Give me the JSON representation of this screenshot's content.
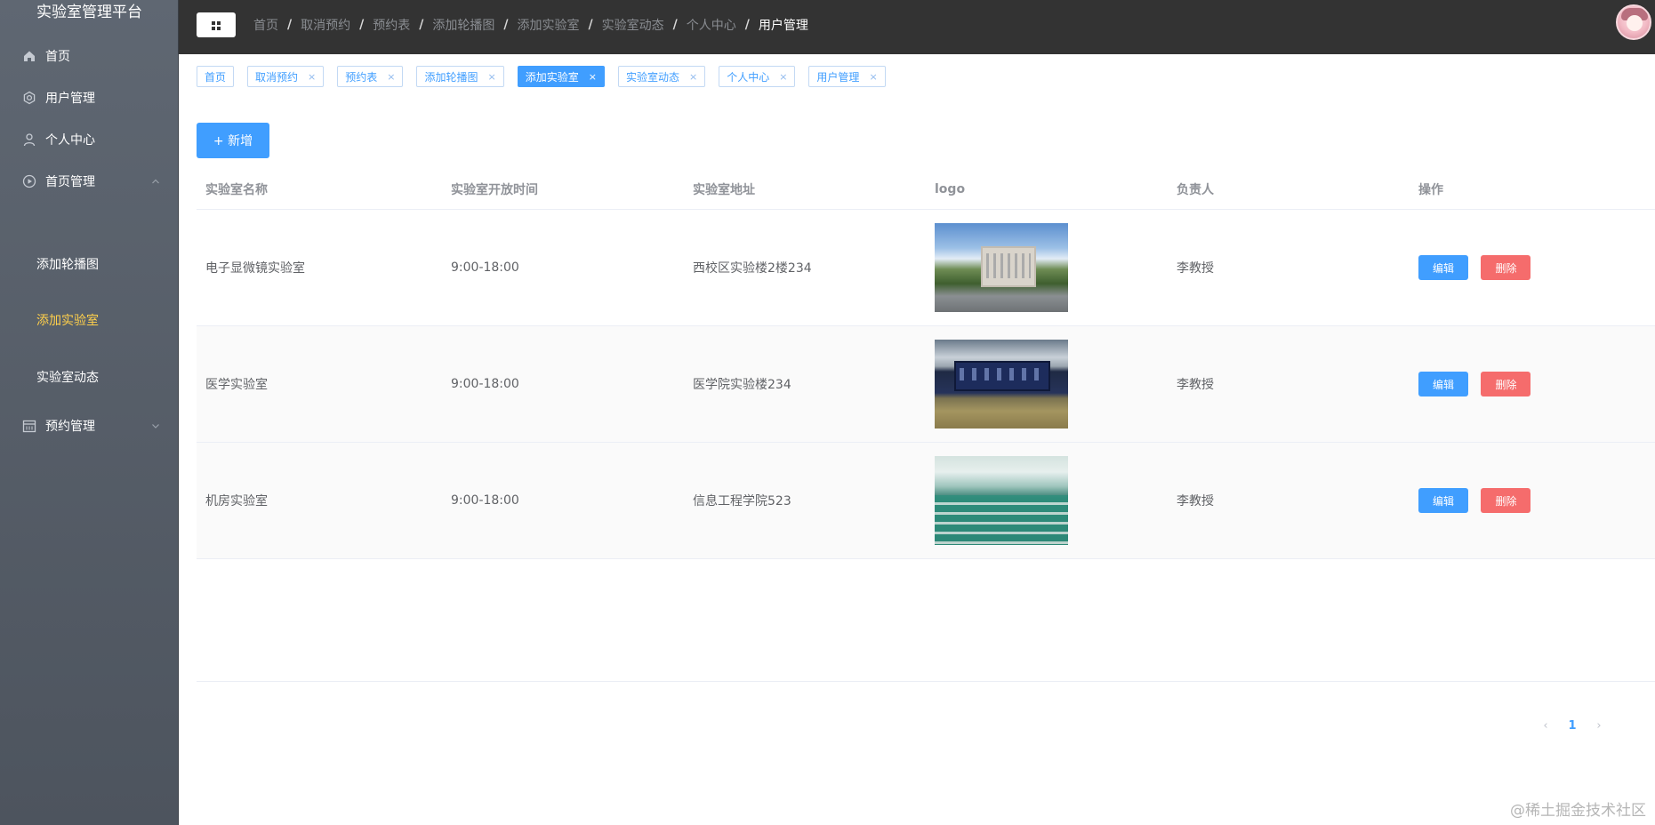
{
  "brand": "实验室管理平台",
  "sidebar": {
    "items": [
      {
        "label": "首页"
      },
      {
        "label": "用户管理"
      },
      {
        "label": "个人中心"
      },
      {
        "label": "首页管理"
      },
      {
        "label": "预约管理"
      }
    ],
    "sub_items": [
      {
        "label": "添加轮播图"
      },
      {
        "label": "添加实验室"
      },
      {
        "label": "实验室动态"
      }
    ],
    "active_sub": "添加实验室"
  },
  "breadcrumb": [
    {
      "label": "首页"
    },
    {
      "label": "取消预约"
    },
    {
      "label": "预约表"
    },
    {
      "label": "添加轮播图"
    },
    {
      "label": "添加实验室"
    },
    {
      "label": "实验室动态"
    },
    {
      "label": "个人中心"
    },
    {
      "label": "用户管理"
    }
  ],
  "tags": [
    {
      "label": "首页"
    },
    {
      "label": "取消预约"
    },
    {
      "label": "预约表"
    },
    {
      "label": "添加轮播图"
    },
    {
      "label": "添加实验室"
    },
    {
      "label": "实验室动态"
    },
    {
      "label": "个人中心"
    },
    {
      "label": "用户管理"
    }
  ],
  "tag_close_glyph": "×",
  "toolbar": {
    "add_label": "+ 新增"
  },
  "table": {
    "headers": [
      "实验室名称",
      "实验室开放时间",
      "实验室地址",
      "logo",
      "负责人",
      "操作"
    ],
    "rows": [
      {
        "name": "电子显微镜实验室",
        "time": "9:00-18:00",
        "address": "西校区实验楼2楼234",
        "owner": "李教授"
      },
      {
        "name": "医学实验室",
        "time": "9:00-18:00",
        "address": "医学院实验楼234",
        "owner": "李教授"
      },
      {
        "name": "机房实验室",
        "time": "9:00-18:00",
        "address": "信息工程学院523",
        "owner": "李教授"
      }
    ],
    "edit_label": "编辑",
    "delete_label": "删除"
  },
  "pagination": {
    "current": "1",
    "prev": "‹",
    "next": "›"
  },
  "watermark": "@稀土掘金技术社区",
  "colors": {
    "primary": "#409eff",
    "danger": "#f56c6c",
    "active_menu": "#ffd04b",
    "topbar": "#333333"
  }
}
